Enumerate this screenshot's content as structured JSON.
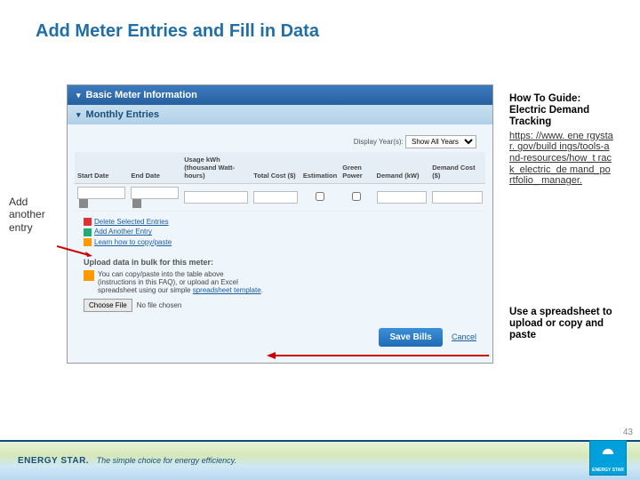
{
  "title": "Add Meter Entries and Fill in Data",
  "left_label": "Add another entry",
  "panel1": "Basic Meter Information",
  "panel2": "Monthly Entries",
  "display_label": "Display Year(s):",
  "display_value": "Show All Years",
  "table": {
    "headers": [
      "Start Date",
      "End Date",
      "Usage kWh (thousand Watt-hours)",
      "Total Cost ($)",
      "Estimation",
      "Green Power",
      "Demand (kW)",
      "Demand Cost ($)"
    ]
  },
  "links": {
    "delete": "Delete Selected Entries",
    "add": "Add Another Entry",
    "learn": "Learn how to copy/paste"
  },
  "bulk": {
    "title": "Upload data in bulk for this meter:",
    "tip_line1": "You can copy/paste into the table above",
    "tip_line2": "(instructions in this FAQ), or upload an Excel",
    "tip_line3_a": "spreadsheet using our simple ",
    "tip_line3_link": "spreadsheet template",
    "choose": "Choose File",
    "nofile": "No file chosen"
  },
  "save": "Save Bills",
  "cancel": "Cancel",
  "right": {
    "guide_title": "How To Guide: Electric Demand Tracking",
    "guide_link": "https: //www. ene rgystar. gov/build ings/tools-and-resources/how_t rack_electric_de mand_portfolio_ manager.",
    "spreadsheet": "Use a spreadsheet to upload or copy and paste"
  },
  "footer": {
    "brand": "ENERGY STAR.",
    "tagline": "The simple choice for energy efficiency."
  },
  "logo_text": "ENERGY STAR",
  "page": "43"
}
